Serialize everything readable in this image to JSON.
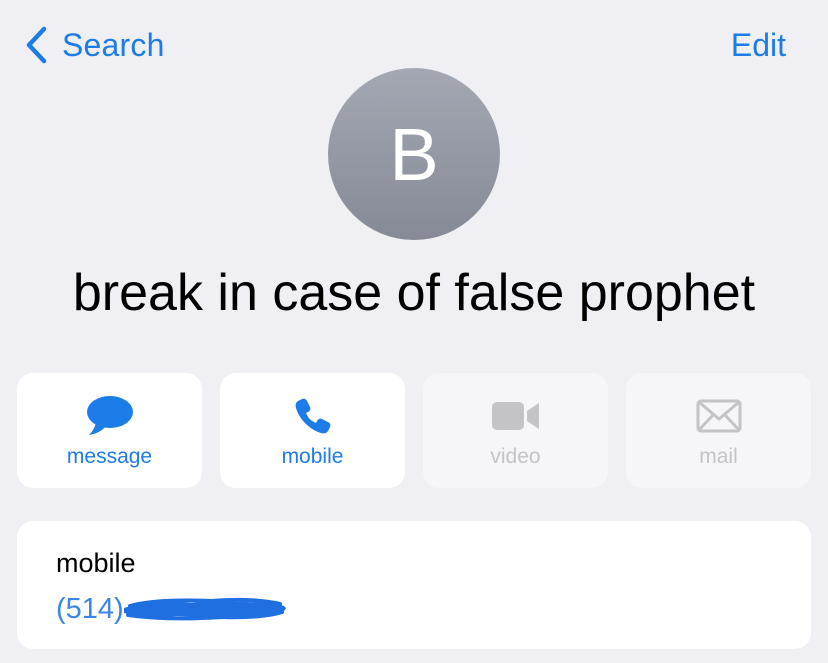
{
  "nav": {
    "back_label": "Search",
    "edit_label": "Edit"
  },
  "contact": {
    "initial": "B",
    "name": "break in case of false prophet"
  },
  "actions": [
    {
      "label": "message",
      "icon": "message-bubble-icon",
      "enabled": true
    },
    {
      "label": "mobile",
      "icon": "phone-icon",
      "enabled": true
    },
    {
      "label": "video",
      "icon": "video-camera-icon",
      "enabled": false
    },
    {
      "label": "mail",
      "icon": "envelope-icon",
      "enabled": false
    }
  ],
  "phone_card": {
    "label": "mobile",
    "number_visible": "(514)"
  },
  "colors": {
    "accent": "#1C7CE8",
    "background": "#EFEFF4",
    "disabled": "#C3C3C8",
    "redaction": "#1F6FE0"
  }
}
